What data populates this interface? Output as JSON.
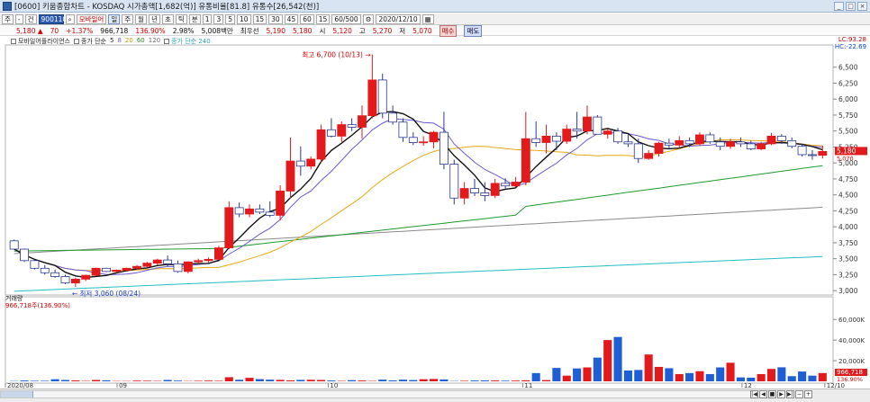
{
  "window": {
    "title": "[0600] 키움종합차트 - KOSDAQ 시가총액[1,682(억)] 유통비율[81.8] 유통수[26,542(천)]"
  },
  "toolbar": {
    "buttons": [
      "주",
      "-",
      "건"
    ],
    "code": "900110",
    "name": "모바일어",
    "periods": [
      "일",
      "주",
      "월",
      "년",
      "초",
      "틱",
      "분",
      "1",
      "3",
      "5",
      "10",
      "15",
      "30",
      "45",
      "60",
      "15"
    ],
    "count": "60/500",
    "date": "2020/12/10"
  },
  "info": {
    "price": "5,180 ▲",
    "change": "70",
    "rate": "+1.37%",
    "volume": "966,718",
    "vol_rate": "136.90%",
    "eps": "2.98%",
    "volume_amt": "5,008백만",
    "high_label": "최우선",
    "p1": "5,190",
    "p2": "5,180",
    "open_lbl": "시",
    "open": "5,120",
    "high_lbl": "고",
    "high": "5,270",
    "low_lbl": "저",
    "low": "5,070",
    "buy": "매수",
    "sell": "매도"
  },
  "legend": {
    "name": "모바일어플라이언스",
    "ma": "종가 단순",
    "ma5": "5",
    "ma8": "8",
    "ma20": "20",
    "ma60": "60",
    "ma120": "120",
    "ma240_lbl": "종가 단순 240"
  },
  "rightinfo": {
    "lc": "LC:93.28",
    "hc": "HC:-22.69"
  },
  "annotations": {
    "high": "최고 6,700 (10/13)",
    "low": "최저 3,060 (08/24)"
  },
  "volume_panel": {
    "title": "거래량",
    "value": "966,718주(136.90%)"
  },
  "colors": {
    "up": "#e31a1c",
    "down": "#1f5fd6",
    "ma5": "#111111",
    "ma8": "#6a5acd",
    "ma20": "#e8a916",
    "ma60": "#1f9a2f",
    "ma120": "#8a8a8a",
    "ma240": "#26bdc4"
  },
  "chart_data": {
    "type": "candlestick",
    "price_ticks": [
      "6,500",
      "6,250",
      "6,000",
      "5,750",
      "5,500",
      "5,250",
      "5,000",
      "4,750",
      "4,500",
      "4,250",
      "4,000",
      "3,750",
      "3,500",
      "3,250",
      "3,000"
    ],
    "volume_ticks": [
      "60,000K",
      "40,000K",
      "20,000K"
    ],
    "x_ticks": [
      "2020/08",
      "09",
      "10",
      "11",
      "12",
      "12/10"
    ],
    "last_price": "5,180",
    "last_price_sub": "5,070",
    "last_volume": "966,718",
    "last_volume_rate": "136.90%",
    "candles": [
      [
        3780,
        3800,
        3650,
        3650
      ],
      [
        3650,
        3660,
        3450,
        3470
      ],
      [
        3470,
        3480,
        3330,
        3350
      ],
      [
        3350,
        3400,
        3250,
        3280
      ],
      [
        3280,
        3330,
        3200,
        3220
      ],
      [
        3220,
        3250,
        3100,
        3120
      ],
      [
        3120,
        3200,
        3060,
        3180
      ],
      [
        3180,
        3250,
        3150,
        3240
      ],
      [
        3240,
        3360,
        3230,
        3350
      ],
      [
        3350,
        3360,
        3290,
        3300
      ],
      [
        3300,
        3330,
        3280,
        3320
      ],
      [
        3320,
        3360,
        3300,
        3350
      ],
      [
        3350,
        3400,
        3330,
        3380
      ],
      [
        3380,
        3450,
        3370,
        3430
      ],
      [
        3430,
        3500,
        3400,
        3480
      ],
      [
        3480,
        3550,
        3380,
        3420
      ],
      [
        3420,
        3470,
        3280,
        3300
      ],
      [
        3300,
        3460,
        3270,
        3450
      ],
      [
        3450,
        3500,
        3420,
        3470
      ],
      [
        3470,
        3520,
        3440,
        3490
      ],
      [
        3490,
        3700,
        3480,
        3670
      ],
      [
        3670,
        4400,
        3650,
        4300
      ],
      [
        4300,
        4380,
        4150,
        4200
      ],
      [
        4200,
        4350,
        4150,
        4280
      ],
      [
        4280,
        4350,
        4200,
        4230
      ],
      [
        4230,
        4400,
        4150,
        4180
      ],
      [
        4180,
        4650,
        4100,
        4560
      ],
      [
        4560,
        5400,
        4450,
        5030
      ],
      [
        5030,
        5260,
        4800,
        4950
      ],
      [
        4950,
        5100,
        4900,
        5060
      ],
      [
        5060,
        5600,
        5000,
        5520
      ],
      [
        5520,
        5700,
        5400,
        5420
      ],
      [
        5420,
        5650,
        5330,
        5600
      ],
      [
        5600,
        5700,
        5500,
        5560
      ],
      [
        5560,
        5900,
        5380,
        5740
      ],
      [
        5740,
        6700,
        5700,
        6300
      ],
      [
        6300,
        6400,
        5700,
        5780
      ],
      [
        5780,
        5900,
        5600,
        5640
      ],
      [
        5640,
        5700,
        5330,
        5400
      ],
      [
        5400,
        5480,
        5280,
        5320
      ],
      [
        5320,
        5420,
        5270,
        5330
      ],
      [
        5330,
        5500,
        5230,
        5480
      ],
      [
        5480,
        5800,
        4900,
        4980
      ],
      [
        4980,
        5050,
        4350,
        4450
      ],
      [
        4450,
        4700,
        4350,
        4600
      ],
      [
        4600,
        4750,
        4480,
        4530
      ],
      [
        4530,
        4700,
        4400,
        4490
      ],
      [
        4490,
        4750,
        4450,
        4680
      ],
      [
        4680,
        4760,
        4600,
        4640
      ],
      [
        4640,
        4780,
        4620,
        4700
      ],
      [
        4700,
        5800,
        4650,
        5380
      ],
      [
        5380,
        5650,
        5250,
        5320
      ],
      [
        5320,
        5600,
        5150,
        5420
      ],
      [
        5420,
        5480,
        5200,
        5340
      ],
      [
        5340,
        5600,
        5300,
        5530
      ],
      [
        5530,
        5800,
        5380,
        5500
      ],
      [
        5500,
        5900,
        5450,
        5720
      ],
      [
        5720,
        5750,
        5450,
        5450
      ],
      [
        5450,
        5550,
        5380,
        5500
      ],
      [
        5500,
        5550,
        5300,
        5330
      ],
      [
        5330,
        5450,
        5250,
        5300
      ],
      [
        5300,
        5380,
        5000,
        5070
      ],
      [
        5070,
        5200,
        5050,
        5150
      ],
      [
        5150,
        5330,
        5100,
        5310
      ],
      [
        5310,
        5380,
        5230,
        5280
      ],
      [
        5280,
        5420,
        5230,
        5350
      ],
      [
        5350,
        5400,
        5250,
        5300
      ],
      [
        5300,
        5480,
        5270,
        5440
      ],
      [
        5440,
        5480,
        5300,
        5330
      ],
      [
        5330,
        5400,
        5200,
        5260
      ],
      [
        5260,
        5380,
        5220,
        5330
      ],
      [
        5330,
        5400,
        5250,
        5300
      ],
      [
        5300,
        5350,
        5200,
        5220
      ],
      [
        5220,
        5330,
        5200,
        5300
      ],
      [
        5300,
        5470,
        5280,
        5420
      ],
      [
        5420,
        5450,
        5300,
        5350
      ],
      [
        5350,
        5400,
        5230,
        5260
      ],
      [
        5260,
        5300,
        5100,
        5130
      ],
      [
        5130,
        5200,
        5050,
        5120
      ],
      [
        5120,
        5270,
        5070,
        5180
      ]
    ],
    "volume_k": [
      300,
      800,
      500,
      500,
      2000,
      1300,
      900,
      400,
      1300,
      1000,
      300,
      300,
      700,
      600,
      400,
      1300,
      700,
      300,
      500,
      700,
      500,
      4000,
      1500,
      3400,
      2100,
      1600,
      1400,
      900,
      1400,
      1500,
      1300,
      800,
      400,
      1100,
      800,
      400,
      1600,
      900,
      1600,
      1200,
      2000,
      2300,
      1800,
      300,
      500,
      800,
      900,
      800,
      600,
      700,
      1000,
      8000,
      1200,
      13000,
      5500,
      12500,
      13500,
      23000,
      40000,
      43000,
      10500,
      11000,
      26000,
      14000,
      12700,
      7000,
      8000,
      9800,
      7000,
      13500,
      18000,
      3800,
      3500,
      7000,
      12000,
      13600,
      5000,
      9500,
      5500,
      8000,
      4800,
      5500,
      1900,
      1000,
      1000,
      1100,
      1500,
      1000,
      900,
      966
    ]
  }
}
